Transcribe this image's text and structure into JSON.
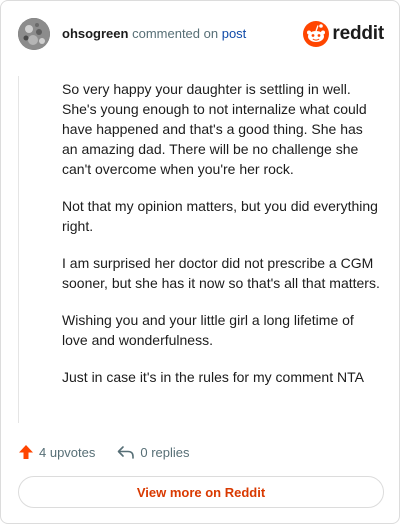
{
  "comment": {
    "author": "ohsogreen",
    "action": "commented on",
    "target_link": "post",
    "paragraphs": [
      "So very happy your daughter is settling in well. She's young enough to not internalize what could have happened and that's a good thing. She has an amazing dad. There will be no challenge she can't overcome when you're her rock.",
      "Not that my opinion matters, but you did everything right.",
      "I am surprised her doctor did not prescribe a CGM sooner, but she has it now so that's all that matters.",
      "Wishing you and your little girl a long lifetime of love and wonderfulness.",
      "Just in case it's in the rules for my comment NTA"
    ]
  },
  "brand": {
    "name": "reddit",
    "icon": "reddit-logo-icon",
    "color": "#ff4500"
  },
  "footer": {
    "upvotes_label": "4 upvotes",
    "replies_label": "0 replies",
    "upvote_icon": "upvote-arrow-icon",
    "reply_icon": "reply-arrow-icon",
    "upvote_color": "#ff4500"
  },
  "view_more_label": "View more on Reddit"
}
